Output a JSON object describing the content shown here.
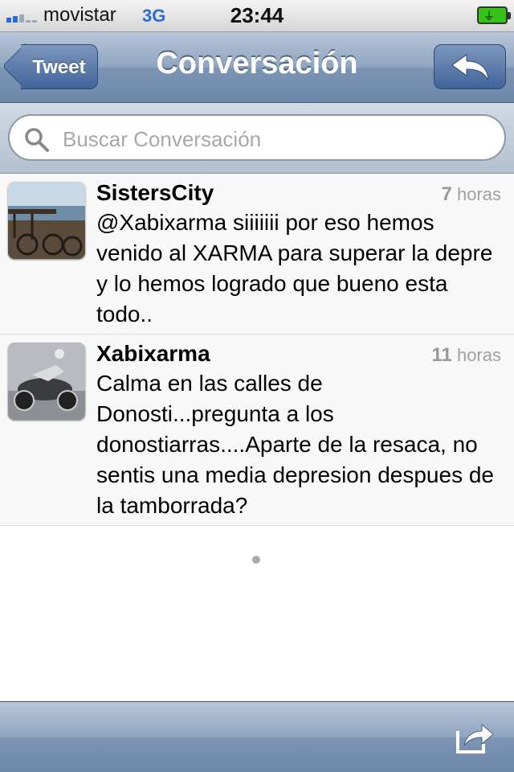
{
  "status_bar": {
    "carrier": "movistar",
    "network": "3G",
    "time": "23:44"
  },
  "navbar": {
    "back_label": "Tweet",
    "title": "Conversación"
  },
  "search": {
    "placeholder": "Buscar Conversación"
  },
  "tweets": [
    {
      "username": "SistersCity",
      "age_number": "7",
      "age_unit": "horas",
      "text": "@Xabixarma siiiiiii por eso hemos venido al XARMA para superar la depre y lo hemos logrado que bueno esta todo.."
    },
    {
      "username": "Xabixarma",
      "age_number": "11",
      "age_unit": "horas",
      "text": "Calma en las calles de Donosti...pregunta a los donostiarras....Aparte de la resaca, no sentis una media depresion despues de la tamborrada?"
    }
  ],
  "icons": {
    "signal": "signal-bars-icon",
    "battery": "battery-charging-icon",
    "reply": "reply-arrow-icon",
    "search": "magnifier-icon",
    "share": "share-icon"
  },
  "colors": {
    "nav_blue": "#6d87aa",
    "button_blue": "#40649a",
    "network_blue": "#2b6ad9",
    "battery_green": "#35c21b"
  }
}
